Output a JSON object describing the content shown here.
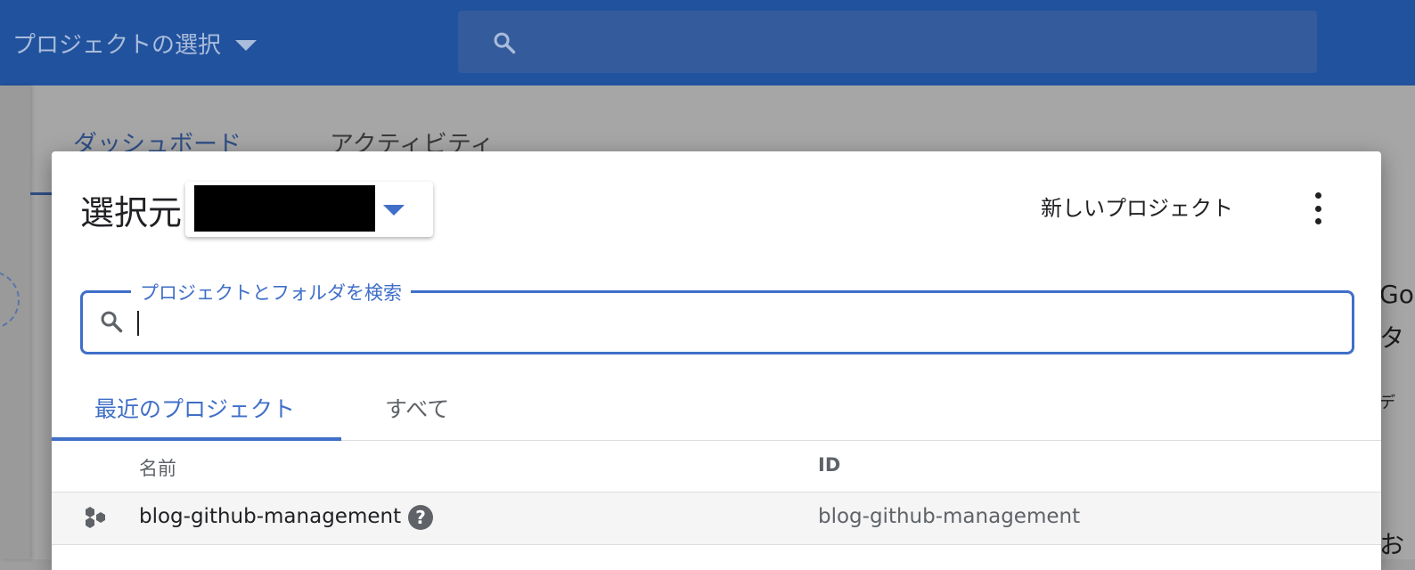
{
  "topbar": {
    "project_picker_label": "プロジェクトの選択",
    "search_placeholder": ""
  },
  "background_page": {
    "tabs": [
      "ダッシュボード",
      "アクティビティ"
    ],
    "right_edge_fragments": [
      "Go",
      "タ",
      "デ",
      "お"
    ]
  },
  "dialog": {
    "title": "選択元",
    "organization_value": "[redacted]",
    "new_project_label": "新しいプロジェクト",
    "search": {
      "label": "プロジェクトとフォルダを検索",
      "value": ""
    },
    "tabs": [
      {
        "label": "最近のプロジェクト",
        "active": true
      },
      {
        "label": "すべて",
        "active": false
      }
    ],
    "table": {
      "columns": [
        "名前",
        "ID"
      ],
      "rows": [
        {
          "name": "blog-github-management",
          "help": "?",
          "id": "blog-github-management"
        }
      ]
    }
  },
  "icons": {
    "topbar_search": "search-icon",
    "picker_caret": "caret-down-icon",
    "more": "more-vert-icon",
    "field_search": "search-icon",
    "project": "project-hexagons-icon",
    "help": "help-circle-icon"
  },
  "colors": {
    "topbar": "#21529d",
    "accent": "#3f6fc8",
    "text": "#202124",
    "secondary_text": "#5f6368"
  }
}
